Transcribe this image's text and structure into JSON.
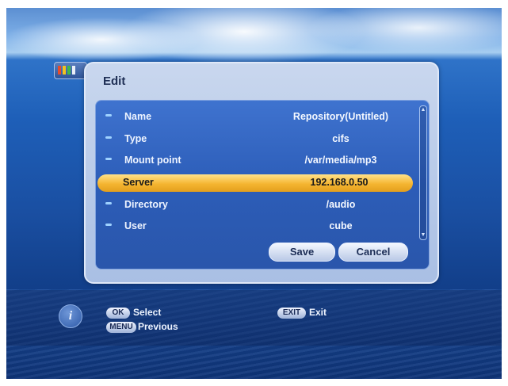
{
  "dialog": {
    "title": "Edit"
  },
  "fields": [
    {
      "label": "Name",
      "value": "Repository(Untitled)"
    },
    {
      "label": "Type",
      "value": "cifs"
    },
    {
      "label": "Mount point",
      "value": "/var/media/mp3"
    },
    {
      "label": "Server",
      "value": "192.168.0.50",
      "selected": true
    },
    {
      "label": "Directory",
      "value": "/audio"
    },
    {
      "label": "User",
      "value": "cube"
    }
  ],
  "buttons": {
    "save": "Save",
    "cancel": "Cancel"
  },
  "footer": {
    "ok_key": "OK",
    "ok_label": "Select",
    "menu_key": "MENU",
    "menu_label": "Previous",
    "exit_key": "EXIT",
    "exit_label": "Exit",
    "info_icon": "i"
  },
  "colors": {
    "selection": "#f5b531",
    "panel": "#2c5db8"
  }
}
